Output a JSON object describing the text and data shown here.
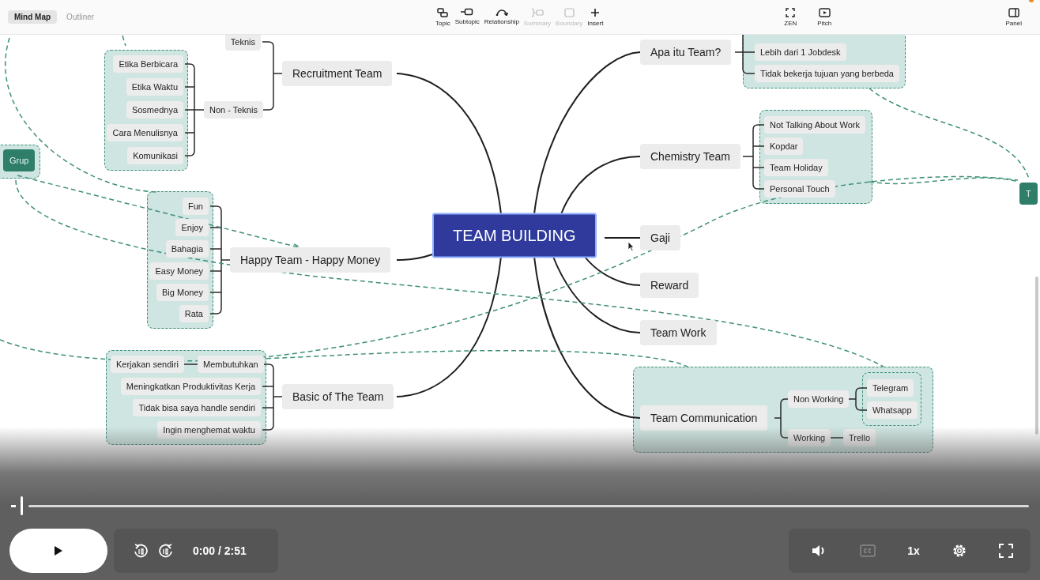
{
  "toolbar": {
    "views": [
      {
        "label": "Mind Map",
        "selected": true
      },
      {
        "label": "Outliner",
        "selected": false
      }
    ],
    "tools": [
      {
        "kind": "topic",
        "label": "Topic",
        "disabled": false
      },
      {
        "kind": "subtopic",
        "label": "Subtopic",
        "disabled": false
      },
      {
        "kind": "relationship",
        "label": "Relationship",
        "disabled": false
      },
      {
        "kind": "summary",
        "label": "Summary",
        "disabled": true
      },
      {
        "kind": "boundary",
        "label": "Boundary",
        "disabled": true
      },
      {
        "kind": "insert",
        "label": "Insert",
        "disabled": false
      }
    ],
    "right_tools": [
      {
        "kind": "zen",
        "label": "ZEN"
      },
      {
        "kind": "pitch",
        "label": "Pitch"
      }
    ],
    "panel": {
      "label": "Panel",
      "notification": true
    }
  },
  "mind_map": {
    "nodes": [
      {
        "kind": "sub",
        "text": "Teknis"
      },
      {
        "kind": "sub",
        "text": "Etika Berbicara"
      },
      {
        "kind": "sub",
        "text": "Etika Waktu"
      },
      {
        "kind": "sub",
        "text": "Sosmednya"
      },
      {
        "kind": "sub",
        "text": "Cara Menulisnya"
      },
      {
        "kind": "sub",
        "text": "Komunikasi"
      },
      {
        "kind": "sub",
        "text": "Non - Teknis"
      },
      {
        "kind": "main",
        "text": "Recruitment Team"
      },
      {
        "kind": "label",
        "text": "Grup"
      },
      {
        "kind": "sub",
        "text": "Fun"
      },
      {
        "kind": "sub",
        "text": "Enjoy"
      },
      {
        "kind": "sub",
        "text": "Bahagia"
      },
      {
        "kind": "sub",
        "text": "Easy Money"
      },
      {
        "kind": "sub",
        "text": "Big Money"
      },
      {
        "kind": "sub",
        "text": "Rata"
      },
      {
        "kind": "main",
        "text": "Happy Team - Happy Money"
      },
      {
        "kind": "sub",
        "text": "Kerjakan sendiri"
      },
      {
        "kind": "sub",
        "text": "Membutuhkan"
      },
      {
        "kind": "sub",
        "text": "Meningkatkan Produktivitas Kerja"
      },
      {
        "kind": "sub",
        "text": "Tidak bisa saya handle sendiri"
      },
      {
        "kind": "sub",
        "text": "Ingin menghemat waktu"
      },
      {
        "kind": "main",
        "text": "Basic of The Team"
      },
      {
        "kind": "root",
        "text": "TEAM BUILDING"
      },
      {
        "kind": "main",
        "text": "Apa itu Team?"
      },
      {
        "kind": "sub",
        "text": "Lebih dari 1 Jobdesk"
      },
      {
        "kind": "sub",
        "text": "Tidak bekerja tujuan yang berbeda"
      },
      {
        "kind": "main",
        "text": "Chemistry Team"
      },
      {
        "kind": "sub",
        "text": "Not Talking About Work"
      },
      {
        "kind": "sub",
        "text": "Kopdar"
      },
      {
        "kind": "sub",
        "text": "Team Holiday"
      },
      {
        "kind": "sub",
        "text": "Personal Touch"
      },
      {
        "kind": "label",
        "text": "T"
      },
      {
        "kind": "main",
        "text": "Gaji"
      },
      {
        "kind": "main",
        "text": "Reward"
      },
      {
        "kind": "main",
        "text": "Team Work"
      },
      {
        "kind": "main",
        "text": "Team Communication"
      },
      {
        "kind": "sub",
        "text": "Non Working"
      },
      {
        "kind": "sub",
        "text": "Telegram"
      },
      {
        "kind": "sub",
        "text": "Whatsapp"
      },
      {
        "kind": "sub",
        "text": "Working"
      },
      {
        "kind": "sub",
        "text": "Trello"
      }
    ]
  },
  "player": {
    "progress": {
      "level": 0
    },
    "time": "0:00 / 2:51",
    "speed": "1x",
    "captions": {
      "disabled": true
    }
  }
}
